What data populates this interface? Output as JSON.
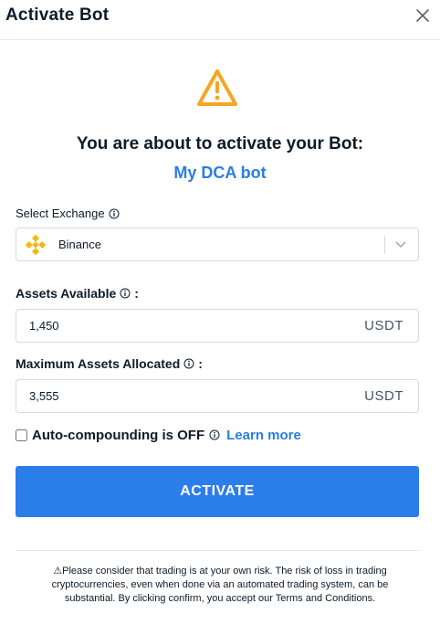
{
  "header": {
    "title": "Activate Bot"
  },
  "main": {
    "heading": "You are about to activate your Bot:",
    "bot_name": "My DCA bot"
  },
  "exchange": {
    "label": "Select Exchange",
    "selected": "Binance"
  },
  "assets_available": {
    "label": "Assets Available",
    "label_suffix": ":",
    "value": "1,450",
    "unit": "USDT"
  },
  "max_assets": {
    "label": "Maximum Assets Allocated",
    "label_suffix": ":",
    "value": "3,555",
    "unit": "USDT"
  },
  "auto_compound": {
    "label": "Auto-compounding is OFF",
    "checked": false,
    "learn_more": "Learn more"
  },
  "activate_label": "ACTIVATE",
  "disclaimer": "⚠Please consider that trading is at your own risk. The risk of loss in trading cryptocurrencies, even when done via an automated trading system, can be substantial. By clicking confirm, you accept our Terms and Conditions.",
  "colors": {
    "accent": "#2b7de9",
    "link": "#2a7de1",
    "warning": "#f5a623",
    "binance": "#f0b90b"
  },
  "icons": [
    "close-icon",
    "warning-icon",
    "info-icon",
    "binance-logo-icon",
    "chevron-down-icon"
  ]
}
